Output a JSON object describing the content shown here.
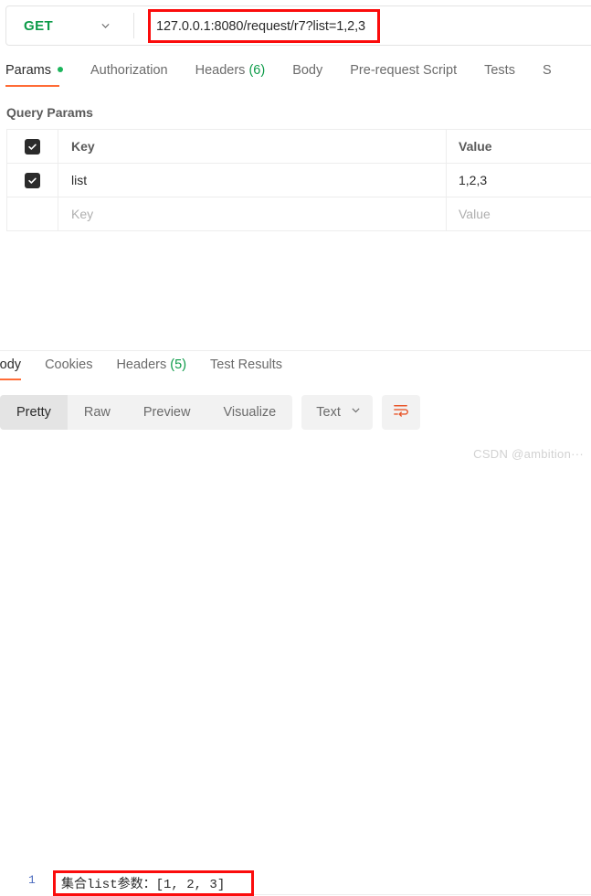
{
  "request_bar": {
    "method": "GET",
    "method_caret_icon": "chevron-down-icon",
    "url": "127.0.0.1:8080/request/r7?list=1,2,3",
    "highlight_color": "#fb0c0c",
    "method_color": "#0d9b49"
  },
  "request_tabs": {
    "accent_color": "#ff6c37",
    "items": [
      {
        "label": "Params",
        "active": true,
        "dot": true
      },
      {
        "label": "Authorization",
        "active": false
      },
      {
        "label": "Headers",
        "count": "(6)",
        "active": false
      },
      {
        "label": "Body",
        "active": false
      },
      {
        "label": "Pre-request Script",
        "active": false
      },
      {
        "label": "Tests",
        "active": false
      },
      {
        "label": "S",
        "active": false
      }
    ]
  },
  "query_params": {
    "title": "Query Params",
    "columns": {
      "key": "Key",
      "value": "Value"
    },
    "rows": [
      {
        "checked": true,
        "key": "list",
        "value": "1,2,3",
        "placeholder": false
      },
      {
        "checked": false,
        "key": "Key",
        "value": "Value",
        "placeholder": true
      }
    ]
  },
  "response_tabs": {
    "items": [
      {
        "label": "Body",
        "active": true
      },
      {
        "label": "Cookies",
        "active": false
      },
      {
        "label": "Headers",
        "count": "(5)",
        "active": false
      },
      {
        "label": "Test Results",
        "active": false
      }
    ]
  },
  "view_toolbar": {
    "segments": [
      {
        "label": "Pretty",
        "active": true
      },
      {
        "label": "Raw",
        "active": false
      },
      {
        "label": "Preview",
        "active": false
      },
      {
        "label": "Visualize",
        "active": false
      }
    ],
    "format": "Text",
    "format_caret_icon": "chevron-down-icon",
    "wrap_icon": "word-wrap-icon",
    "wrap_icon_color": "#e8562a"
  },
  "response_body": {
    "line_number": "1",
    "content": "集合list参数：[1, 2, 3]"
  },
  "watermark": "CSDN @ambition···"
}
